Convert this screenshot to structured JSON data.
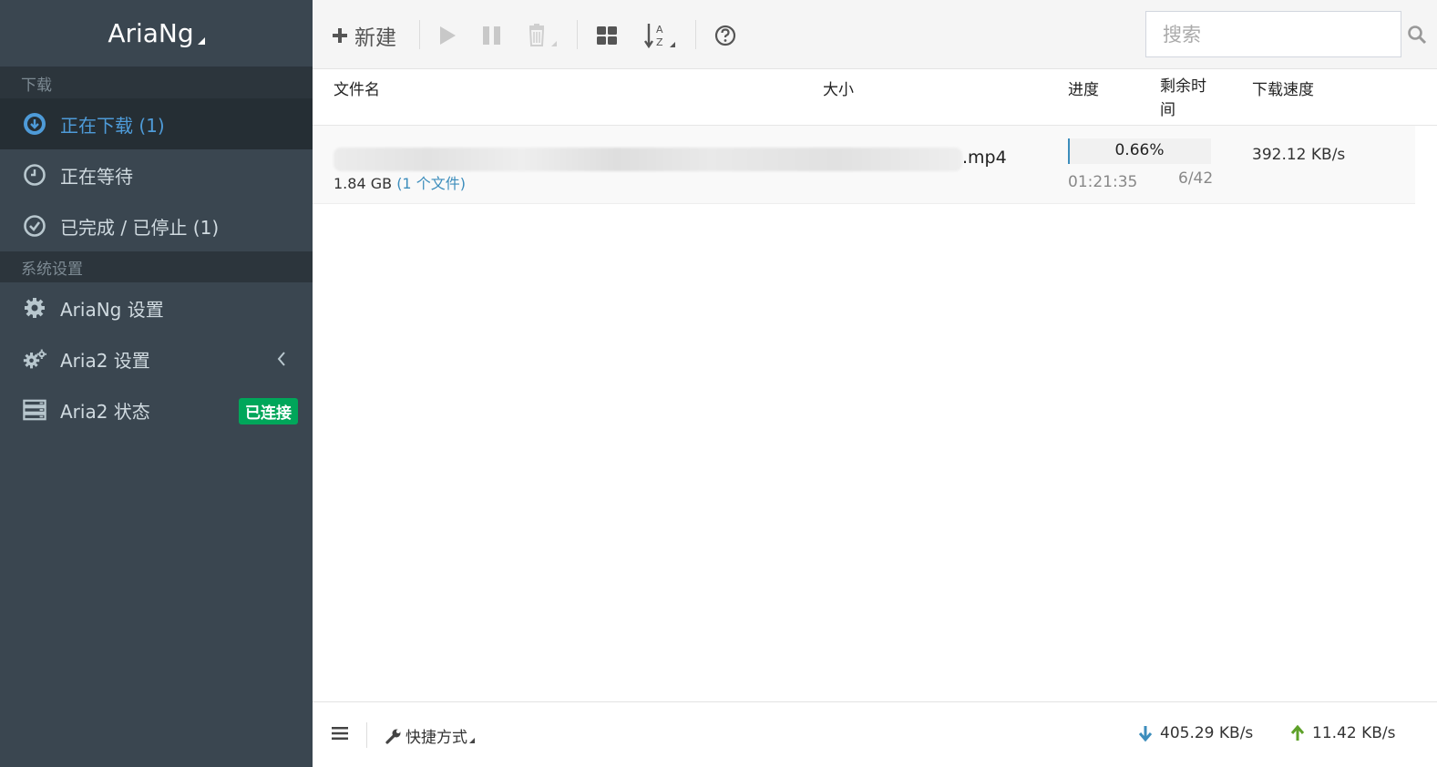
{
  "brand": {
    "title": "AriaNg"
  },
  "sidebar": {
    "section_downloads": "下载",
    "items": [
      {
        "label": "正在下载 (1)",
        "icon": "download-circle-icon"
      },
      {
        "label": "正在等待",
        "icon": "clock-icon"
      },
      {
        "label": "已完成 / 已停止 (1)",
        "icon": "check-circle-icon"
      }
    ],
    "section_settings": "系统设置",
    "settings_items": [
      {
        "label": "AriaNg 设置",
        "icon": "gear-icon"
      },
      {
        "label": "Aria2 设置",
        "icon": "gears-icon"
      },
      {
        "label": "Aria2 状态",
        "icon": "server-icon",
        "badge": "已连接"
      }
    ]
  },
  "toolbar": {
    "new_label": "新建",
    "search_placeholder": "搜索"
  },
  "table": {
    "headers": {
      "name": "文件名",
      "size": "大小",
      "progress": "进度",
      "remaining": "剩余时间",
      "speed": "下载速度"
    },
    "rows": [
      {
        "name_ext": ".mp4",
        "size": "1.84 GB",
        "files": "(1 个文件)",
        "progress": "0.66%",
        "progress_value": 0.66,
        "remaining": "01:21:35",
        "connections": "6/42",
        "speed": "392.12 KB/s"
      }
    ]
  },
  "footer": {
    "shortcuts": "快捷方式",
    "download_speed": "405.29 KB/s",
    "upload_speed": "11.42 KB/s"
  },
  "colors": {
    "sidebar_bg": "#3a4650",
    "active_blue": "#4e9bd8",
    "badge_green": "#00a65a",
    "link_blue": "#3c8dbc",
    "upload_green": "#5ea129"
  }
}
